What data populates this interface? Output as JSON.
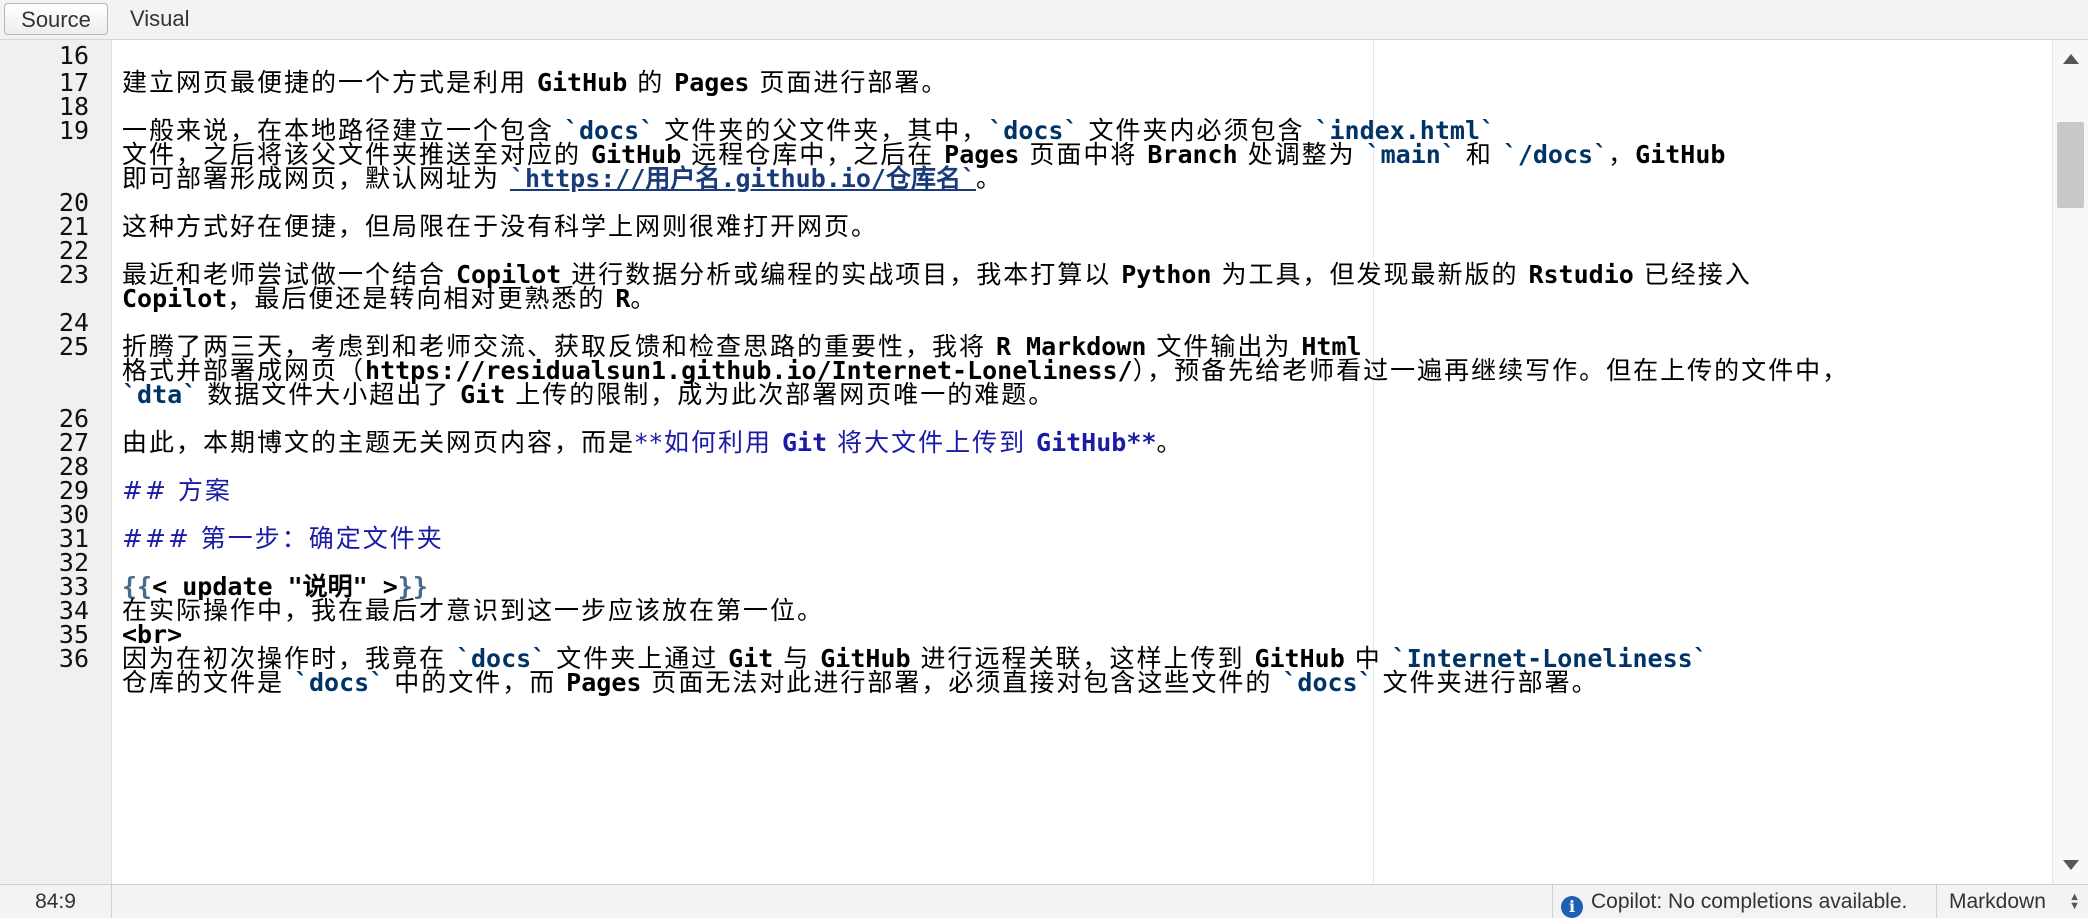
{
  "tabs": {
    "source": "Source",
    "visual": "Visual"
  },
  "gutter": [
    "16",
    "17",
    "18",
    "19",
    "20",
    "21",
    "22",
    "23",
    "24",
    "25",
    "26",
    "27",
    "28",
    "29",
    "30",
    "31",
    "32",
    "33",
    "34",
    "35",
    "36"
  ],
  "lines": {
    "l17": [
      "建立网页最便捷的一个方式是利用 ",
      "GitHub",
      " 的 ",
      "Pages",
      " 页面进行部署。"
    ],
    "l19a": [
      "一般来说，在本地路径建立一个包含 ",
      "`docs`",
      " 文件夹的父文件夹，其中，",
      "`docs`",
      " 文件夹内必须包含 ",
      "`index.html`"
    ],
    "l19b": [
      "文件，之后将该父文件夹推送至对应的 ",
      "GitHub",
      " 远程仓库中，之后在 ",
      "Pages",
      " 页面中将 ",
      "Branch",
      " 处调整为 ",
      "`main`",
      " 和 ",
      "`/docs`",
      "，",
      "GitHub"
    ],
    "l19c": [
      "即可部署形成网页，默认网址为 ",
      "`https://用户名.github.io/仓库名`",
      "。"
    ],
    "l21": [
      "这种方式好在便捷，但局限在于没有科学上网则很难打开网页。"
    ],
    "l23a": [
      "最近和老师尝试做一个结合 ",
      "Copilot",
      " 进行数据分析或编程的实战项目，我本打算以 ",
      "Python",
      " 为工具，但发现最新版的 ",
      "Rstudio",
      " 已经接入"
    ],
    "l23b": [
      "Copilot",
      "，最后便还是转向相对更熟悉的 ",
      "R",
      "。"
    ],
    "l25a": [
      "折腾了两三天，考虑到和老师交流、获取反馈和检查思路的重要性，我将 ",
      "R Markdown",
      " 文件输出为 ",
      "Html"
    ],
    "l25b": [
      "格式并部署成网页（",
      "https://residualsun1.github.io/Internet-Loneliness/",
      "），预备先给老师看过一遍再继续写作。但在上传的文件中，"
    ],
    "l25c": [
      "`dta`",
      " 数据文件大小超出了 ",
      "Git",
      " 上传的限制，成为此次部署网页唯一的难题。"
    ],
    "l27": [
      "由此，本期博文的主题无关网页内容，而是",
      "**如何利用 ",
      "Git",
      " 将大文件上传到 ",
      "GitHub**",
      "。"
    ],
    "l29": [
      "## 方案"
    ],
    "l31": [
      "### 第一步：确定文件夹"
    ],
    "l33": [
      "{{",
      "< update \"说明\" >",
      "}}"
    ],
    "l34": [
      "在实际操作中，我在最后才意识到这一步应该放在第一位。"
    ],
    "l35": [
      "<br>"
    ],
    "l36": [
      "因为在初次操作时，我竟在 ",
      "`docs`",
      " 文件夹上通过 ",
      "Git",
      " 与 ",
      "GitHub",
      " 进行远程关联，这样上传到 ",
      "GitHub",
      " 中 ",
      "`Internet-Loneliness`"
    ],
    "l37": [
      "仓库的文件是 ",
      "`docs`",
      " 中的文件，而 ",
      "Pages",
      " 页面无法对此进行部署，必须直接对包含这些文件的 ",
      "`docs`",
      " 文件夹进行部署。"
    ]
  },
  "status": {
    "cursor_pos": "84:9",
    "copilot": "Copilot: No completions available.",
    "language": "Markdown"
  },
  "icons": [
    "info-icon",
    "scroll-up-arrow-icon",
    "scroll-down-arrow-icon",
    "updown-icon"
  ]
}
